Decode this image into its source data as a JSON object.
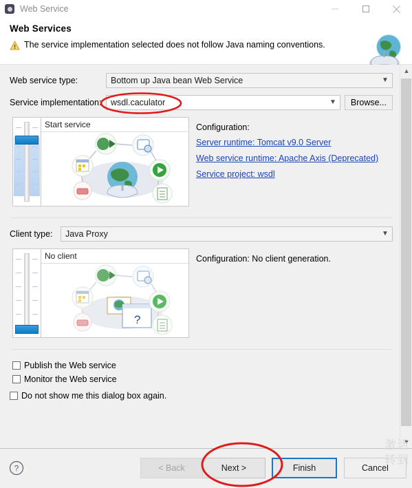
{
  "window": {
    "title": "Web Service",
    "icon": "app-gear-icon",
    "controls": {
      "minimize": "Minimize",
      "maximize": "Maximize",
      "close": "Close"
    }
  },
  "header": {
    "title": "Web Services",
    "message": "The service implementation selected does not follow Java naming conventions.",
    "message_severity": "warning",
    "banner_icon": "web-service-globe-icon"
  },
  "form": {
    "web_service_type": {
      "label": "Web service type:",
      "value": "Bottom up Java bean Web Service"
    },
    "service_implementation": {
      "label": "Service implementation:",
      "value": "wsdl.caculator",
      "placeholder": "",
      "browse_label": "Browse..."
    }
  },
  "service_panel": {
    "illustration_title": "Start service",
    "slider_position": "second-from-top",
    "configuration": {
      "title": "Configuration:",
      "links": [
        "Server runtime: Tomcat v9.0 Server",
        "Web service runtime: Apache Axis (Deprecated)",
        "Service project: wsdl"
      ]
    }
  },
  "client_panel": {
    "client_type": {
      "label": "Client type:",
      "value": "Java Proxy"
    },
    "illustration_title": "No client",
    "slider_position": "bottom",
    "configuration_text": "Configuration: No client generation."
  },
  "checkboxes": [
    {
      "label": "Publish the Web service",
      "checked": false
    },
    {
      "label": "Monitor the Web service",
      "checked": false
    },
    {
      "label": "Do not show me this dialog box again.",
      "checked": false
    }
  ],
  "buttons": {
    "help": "?",
    "back": "< Back",
    "back_disabled": true,
    "next": "Next >",
    "finish": "Finish",
    "cancel": "Cancel",
    "default_button": "Finish"
  },
  "annotations": {
    "color": "#e01b1b",
    "items": [
      {
        "name": "service-implementation-circle",
        "target": "wsdl.caculator"
      },
      {
        "name": "next-button-circle",
        "target": "Next >"
      }
    ]
  },
  "watermark": {
    "line1": "激活",
    "line2": "转到"
  },
  "colors": {
    "link": "#1a44b8",
    "accent": "#1577c6",
    "warning": "#f0c419",
    "annotation": "#e01b1b"
  }
}
